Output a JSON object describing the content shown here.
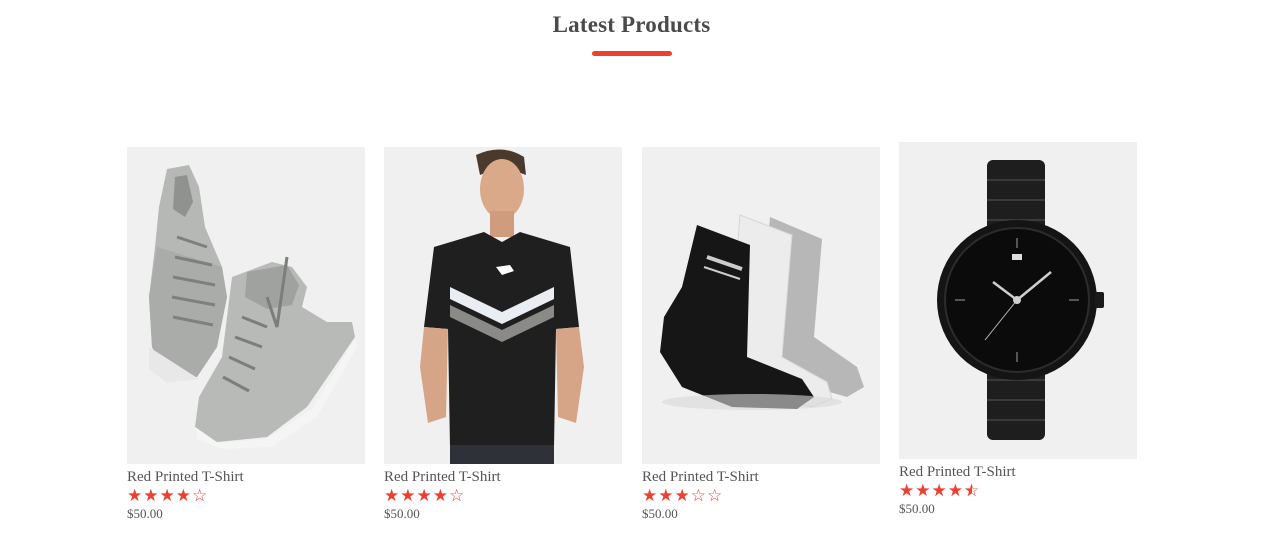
{
  "section": {
    "title": "Latest Products",
    "accent_color": "#ee4030"
  },
  "products": [
    {
      "name": "Red Printed T-Shirt",
      "price": "$50.00",
      "rating": 4,
      "image": "grey-high-top-sneakers"
    },
    {
      "name": "Red Printed T-Shirt",
      "price": "$50.00",
      "rating": 4,
      "image": "black-puma-t-shirt"
    },
    {
      "name": "Red Printed T-Shirt",
      "price": "$50.00",
      "rating": 3,
      "image": "socks-three-pack"
    },
    {
      "name": "Red Printed T-Shirt",
      "price": "$50.00",
      "rating": 4.5,
      "image": "black-analog-watch"
    }
  ]
}
